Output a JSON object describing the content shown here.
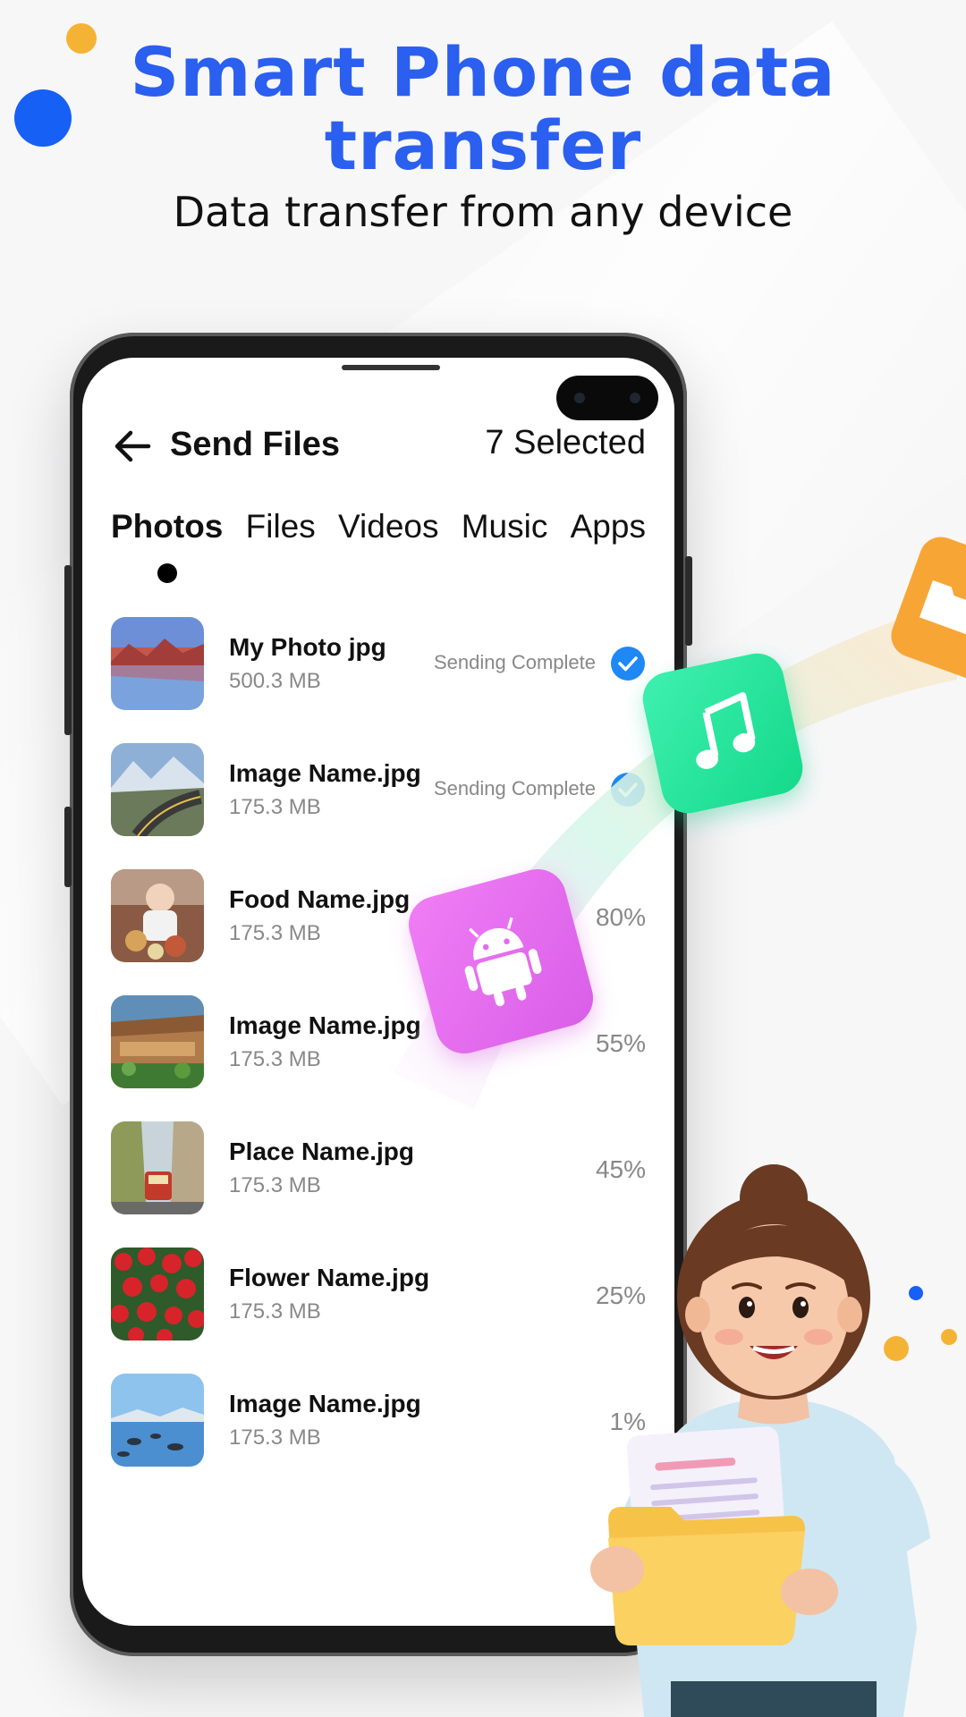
{
  "promo": {
    "title_line1": "Smart Phone data",
    "title_line2": "transfer",
    "subtitle": "Data transfer from any device"
  },
  "app": {
    "header_title": "Send Files",
    "selected_text": "7 Selected"
  },
  "tabs": [
    {
      "label": "Photos",
      "active": true
    },
    {
      "label": "Files",
      "active": false
    },
    {
      "label": "Videos",
      "active": false
    },
    {
      "label": "Music",
      "active": false
    },
    {
      "label": "Apps",
      "active": false
    }
  ],
  "files": [
    {
      "name": "My Photo jpg",
      "size": "500.3 MB",
      "status": "Sending Complete",
      "progress": null
    },
    {
      "name": "Image Name.jpg",
      "size": "175.3 MB",
      "status": "Sending Complete",
      "progress": null
    },
    {
      "name": "Food Name.jpg",
      "size": "175.3 MB",
      "status": "",
      "progress": "80%"
    },
    {
      "name": "Image Name.jpg",
      "size": "175.3 MB",
      "status": "",
      "progress": "55%"
    },
    {
      "name": "Place Name.jpg",
      "size": "175.3 MB",
      "status": "",
      "progress": "45%"
    },
    {
      "name": "Flower Name.jpg",
      "size": "175.3 MB",
      "status": "",
      "progress": "25%"
    },
    {
      "name": "Image Name.jpg",
      "size": "175.3 MB",
      "status": "",
      "progress": "1%"
    }
  ],
  "colors": {
    "accent_blue": "#2a5ff0",
    "check_blue": "#1e88f5",
    "music_green": "#2fe6a0",
    "android_pink": "#e472f2",
    "files_orange": "#f7a636",
    "dot_yellow": "#f5b335"
  },
  "icons": {
    "back": "arrow-left-icon",
    "complete": "check-circle-icon",
    "music": "music-note-icon",
    "android": "android-icon",
    "files": "folder-icon"
  }
}
